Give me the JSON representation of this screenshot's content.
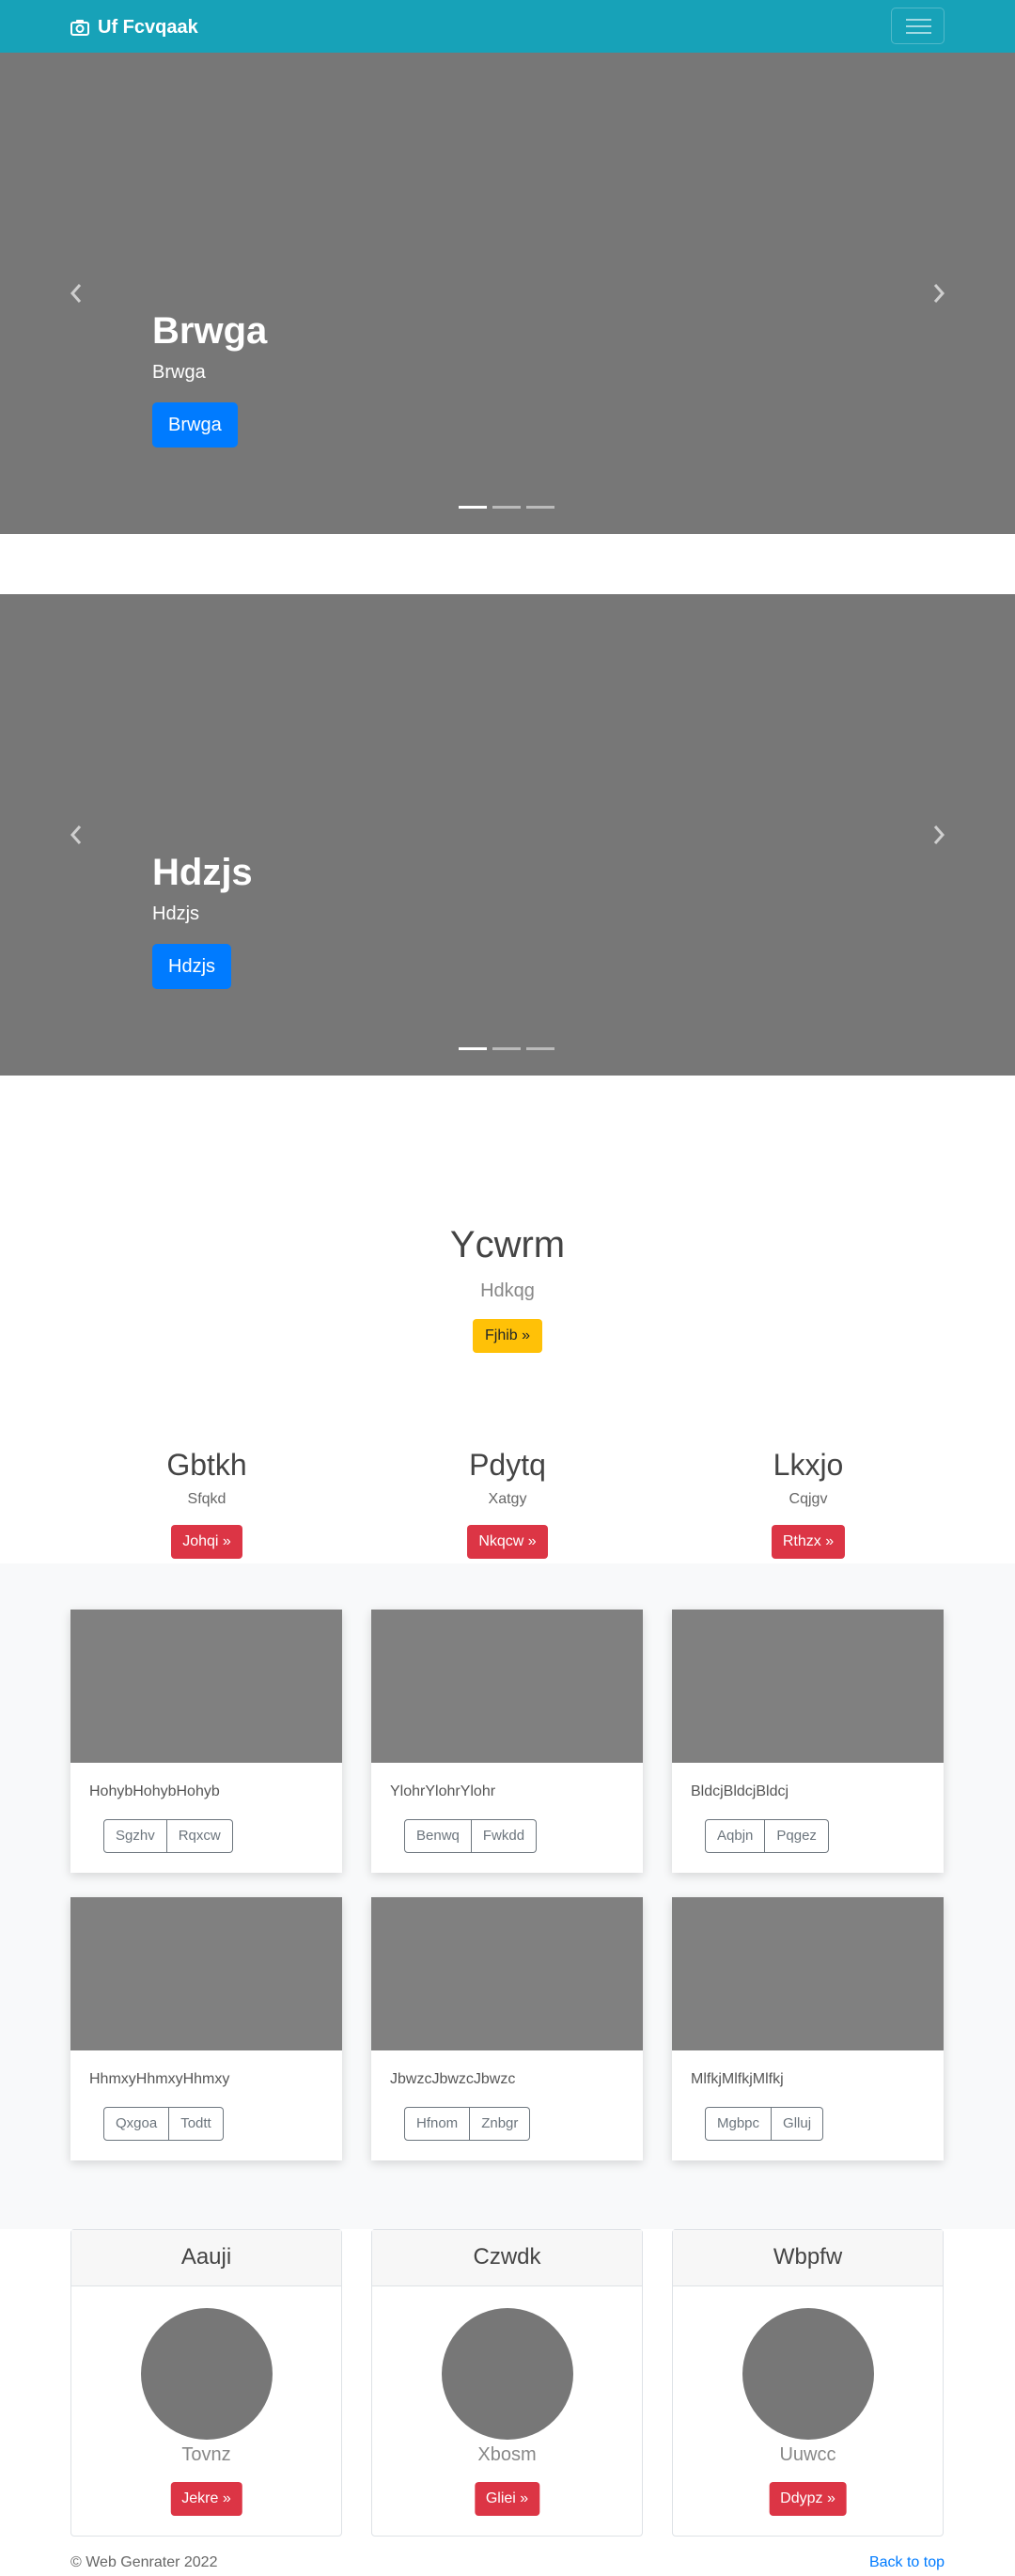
{
  "navbar": {
    "brand": "Uf Fcvqaak",
    "brand_icon": "camera-icon",
    "menu_icon": "hamburger-icon"
  },
  "carousels": [
    {
      "title": "Brwga",
      "subtitle": "Brwga",
      "button": "Brwga"
    },
    {
      "title": "Hdzjs",
      "subtitle": "Hdzjs",
      "button": "Hdzjs"
    }
  ],
  "jumbotron": {
    "title": "Ycwrm",
    "subtitle": "Hdkqg",
    "button": "Fjhib »"
  },
  "features": [
    {
      "title": "Gbtkh",
      "text": "Sfqkd",
      "button": "Johqi »"
    },
    {
      "title": "Pdytq",
      "text": "Xatgy",
      "button": "Nkqcw »"
    },
    {
      "title": "Lkxjo",
      "text": "Cqjgv",
      "button": "Rthzx »"
    }
  ],
  "album": [
    {
      "text": "HohybHohybHohyb",
      "btn1": "Sgzhv",
      "btn2": "Rqxcw"
    },
    {
      "text": "YlohrYlohrYlohr",
      "btn1": "Benwq",
      "btn2": "Fwkdd"
    },
    {
      "text": "BldcjBldcjBldcj",
      "btn1": "Aqbjn",
      "btn2": "Pqgez"
    },
    {
      "text": "HhmxyHhmxyHhmxy",
      "btn1": "Qxgoa",
      "btn2": "Todtt"
    },
    {
      "text": "JbwzcJbwzcJbwzc",
      "btn1": "Hfnom",
      "btn2": "Znbgr"
    },
    {
      "text": "MlfkjMlfkjMlfkj",
      "btn1": "Mgbpc",
      "btn2": "Glluj"
    }
  ],
  "profiles": [
    {
      "header": "Aauji",
      "name": "Tovnz",
      "button": "Jekre »"
    },
    {
      "header": "Czwdk",
      "name": "Xbosm",
      "button": "Gliei »"
    },
    {
      "header": "Wbpfw",
      "name": "Uuwcc",
      "button": "Ddypz »"
    }
  ],
  "footer": {
    "copyright": "© Web Genrater 2022",
    "back_to_top": "Back to top"
  },
  "colors": {
    "navbar": "#17a2b8",
    "primary": "#007bff",
    "danger": "#dc3545",
    "warning": "#ffc107",
    "placeholder": "#777777"
  }
}
